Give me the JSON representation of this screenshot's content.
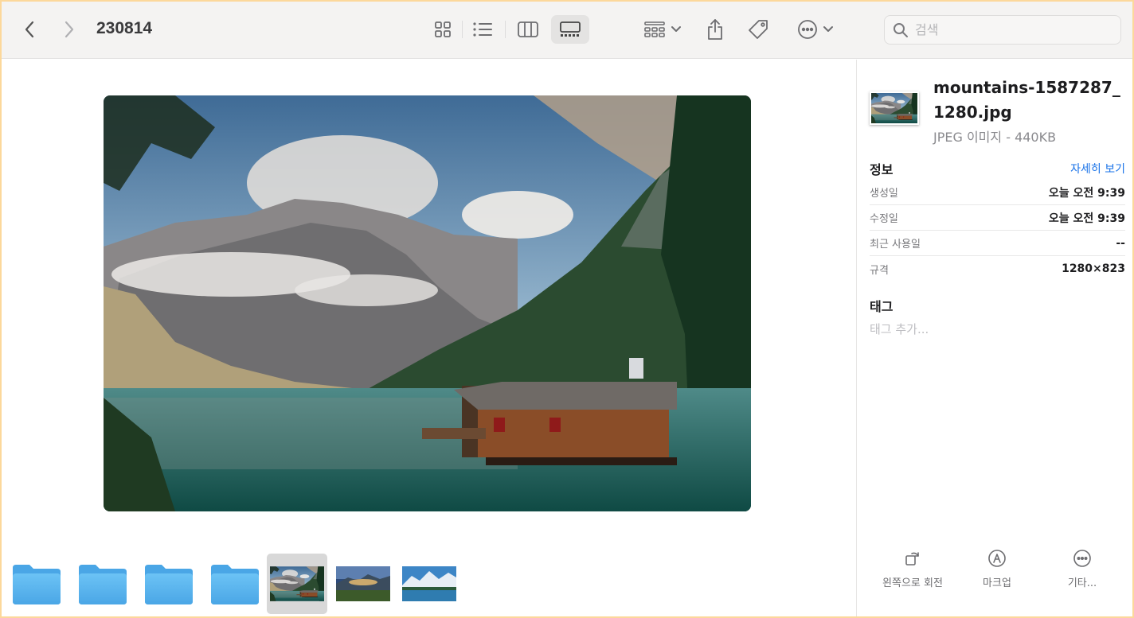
{
  "toolbar": {
    "title": "230814",
    "back_icon": "chevron-left-icon",
    "forward_icon": "chevron-right-icon",
    "view_icons": [
      "icon-view-icon",
      "list-view-icon",
      "column-view-icon",
      "gallery-view-icon"
    ],
    "active_view": "gallery",
    "search_placeholder": "검색"
  },
  "preview": {
    "image_name": "mountains-1587287_1280.jpg"
  },
  "filmstrip": {
    "items": [
      {
        "kind": "folder"
      },
      {
        "kind": "folder"
      },
      {
        "kind": "folder"
      },
      {
        "kind": "folder"
      },
      {
        "kind": "image",
        "selected": true
      },
      {
        "kind": "image"
      },
      {
        "kind": "image"
      }
    ]
  },
  "inspector": {
    "filename": "mountains-1587287_1280.jpg",
    "filetype": "JPEG 이미지 - 440KB",
    "info_title": "정보",
    "more_label": "자세히 보기",
    "rows": [
      {
        "key": "생성일",
        "value": "오늘 오전 9:39"
      },
      {
        "key": "수정일",
        "value": "오늘 오전 9:39"
      },
      {
        "key": "최근 사용일",
        "value": "--"
      },
      {
        "key": "규격",
        "value": "1280×823"
      }
    ],
    "tags_title": "태그",
    "tags_placeholder": "태그 추가..."
  },
  "actions": [
    {
      "label": "왼쪽으로 회전",
      "icon": "rotate-left-icon"
    },
    {
      "label": "마크업",
      "icon": "markup-icon"
    },
    {
      "label": "기타...",
      "icon": "more-icon"
    }
  ],
  "colors": {
    "accent": "#1a73e8",
    "folder": "#5bb4ee",
    "window_frame": "#fcd89b"
  }
}
